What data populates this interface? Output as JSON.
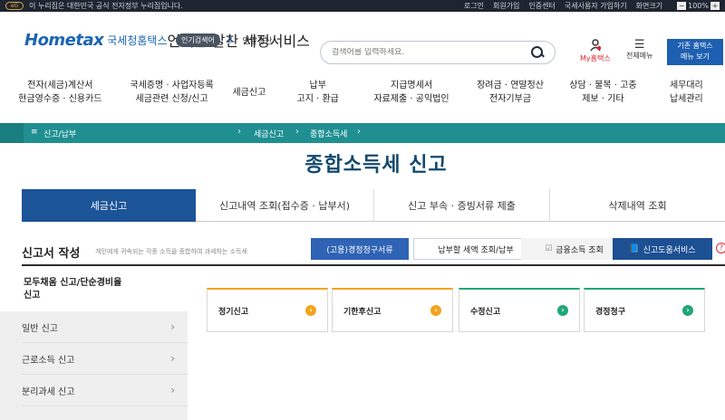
{
  "topbar": {
    "eg_label": "eG",
    "notice": "이 누리집은 대한민국 공식 전자정부 누리집입니다.",
    "links": [
      "로그인",
      "회원가입",
      "인증센터",
      "국세사용자 가입하기",
      "화면크기"
    ],
    "zoom": "100%",
    "zoom_minus": "−",
    "zoom_plus": "+"
  },
  "header": {
    "logo_brand": "Hometax",
    "logo_org": "국세청홈택스",
    "logo_tiny": "언제든 알찬 세정서비스",
    "popular_label": "인기검색어",
    "popular_rank": "2.",
    "popular_keyword": "연말정산",
    "search_placeholder": "검색어를 입력하세요.",
    "my_label": "My홈택스",
    "menu_label": "전체메뉴",
    "basic_line1": "기존 홈택스",
    "basic_line2": "메뉴 보기"
  },
  "gnb": [
    {
      "l1": "전자(세금)계산서",
      "l2": "현금영수증 · 신용카드"
    },
    {
      "l1": "국세증명 · 사업자등록",
      "l2": "세금관련 신청/신고"
    },
    {
      "l1": "세금신고",
      "l2": ""
    },
    {
      "l1": "납부",
      "l2": "고지 · 환급"
    },
    {
      "l1": "지급명세서",
      "l2": "자료제출 · 공익법인"
    },
    {
      "l1": "장려금 · 연말정산",
      "l2": "전자기부금"
    },
    {
      "l1": "상담 · 불복 · 고충",
      "l2": "제보 · 기타"
    },
    {
      "l1": "세무대리",
      "l2": "납세관리"
    }
  ],
  "breadcrumb": {
    "menu_icon": "≡",
    "level1": "신고/납부",
    "level2": "세금신고",
    "level3": "종합소득세"
  },
  "page_title": "종합소득세 신고",
  "tabs": [
    "세금신고",
    "신고내역 조회(접수증 · 납부서)",
    "신고 부속 · 증빙서류 제출",
    "삭제내역 조회"
  ],
  "section": {
    "title": "신고서 작성",
    "desc": "개인에게 귀속되는 각종 소득을 종합하여 과세하는 소득세",
    "btn_correct": "(고용)경정청구서류",
    "btn_defer": "납부할 세액 조회/납부",
    "btn_finance": "금융소득 조회",
    "btn_guide": "신고도움서비스",
    "help": "?"
  },
  "sidebar": {
    "active_line1": "모두채움 신고/단순경비율",
    "active_line2": "신고",
    "items": [
      "일반 신고",
      "근로소득 신고",
      "분리과세 신고"
    ]
  },
  "cards": [
    "정기신고",
    "기한후신고",
    "수정신고",
    "경정청구"
  ],
  "colors": {
    "brand": "#1c5498",
    "teal": "#1f8f92",
    "title": "#12496e",
    "orange": "#f2a41c",
    "green": "#21a67a"
  }
}
